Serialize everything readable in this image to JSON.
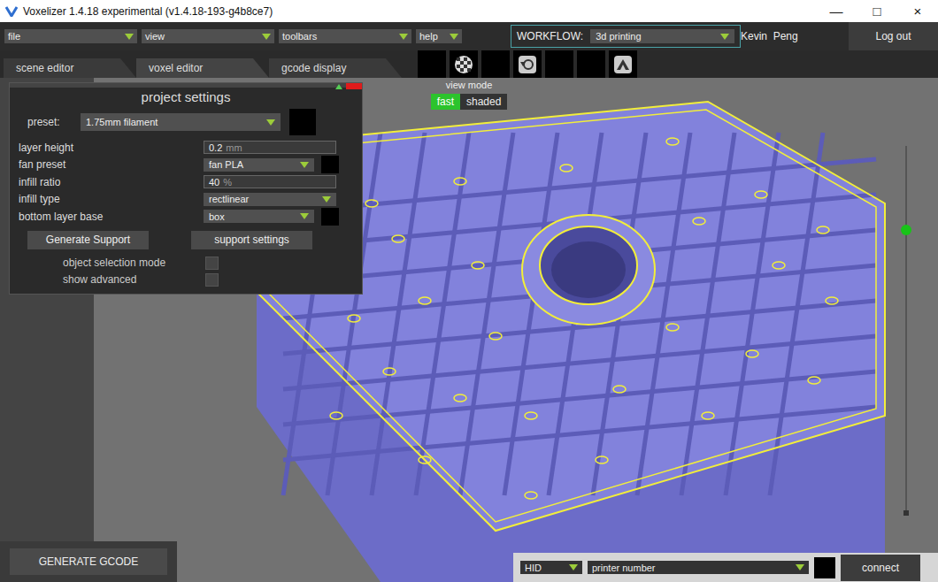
{
  "window": {
    "title": "Voxelizer 1.4.18 experimental (v1.4.18-193-g4b8ce7)",
    "controls": [
      "—",
      "□",
      "×"
    ]
  },
  "menus": [
    {
      "label": "file"
    },
    {
      "label": "view"
    },
    {
      "label": "toolbars"
    },
    {
      "label": "help"
    }
  ],
  "workflow": {
    "label": "WORKFLOW:",
    "value": "3d printing"
  },
  "user": "Kevin  Peng",
  "logout": "Log out",
  "tabs": [
    {
      "label": "scene editor",
      "selected": false
    },
    {
      "label": "voxel editor",
      "selected": true
    },
    {
      "label": "gcode display",
      "selected": false
    }
  ],
  "view_mode": {
    "label": "view mode",
    "options": [
      {
        "label": "fast",
        "selected": true
      },
      {
        "label": "shaded",
        "selected": false
      }
    ]
  },
  "project_settings": {
    "title": "project settings",
    "preset": {
      "label": "preset:",
      "value": "1.75mm filament"
    },
    "fields": [
      {
        "label": "layer height",
        "kind": "input",
        "value": "0.2",
        "unit": "mm",
        "swatch": false
      },
      {
        "label": "fan preset",
        "kind": "dropdown",
        "value": "fan PLA",
        "unit": "",
        "swatch": true
      },
      {
        "label": "infill ratio",
        "kind": "input",
        "value": "40",
        "unit": "%",
        "swatch": false
      },
      {
        "label": "infill type",
        "kind": "dropdown",
        "value": "rectlinear",
        "unit": "",
        "swatch": false
      },
      {
        "label": "bottom layer base",
        "kind": "dropdown",
        "value": "box",
        "unit": "",
        "swatch": true
      }
    ],
    "buttons": [
      "Generate Support",
      "support settings"
    ],
    "checks": [
      {
        "label": "object selection mode",
        "checked": false
      },
      {
        "label": "show advanced",
        "checked": false
      }
    ]
  },
  "generate_button": "GENERATE GCODE",
  "connection": {
    "port": "HID",
    "printer": "printer number",
    "button": "connect"
  },
  "layer_slider": {
    "level": 0.77
  }
}
